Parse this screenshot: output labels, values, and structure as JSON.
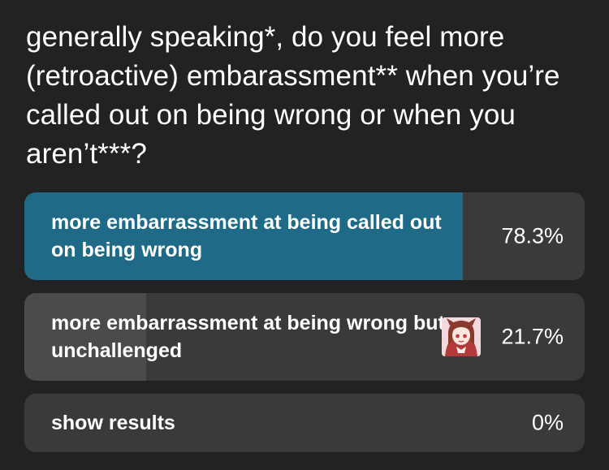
{
  "poll": {
    "question": "generally speaking*, do you feel more (retroactive) embarassment** when you’re called out on being wrong or when you aren’t***?",
    "colors": {
      "background": "#222222",
      "option_bg": "#3a3a3a",
      "selected_fill": "#1f6a86",
      "unselected_fill": "#4b4b4b",
      "text": "#ffffff"
    },
    "options": [
      {
        "label": "more embarrassment at being called out on being wrong",
        "percent": "78.3%",
        "fraction": 0.783,
        "selected": true
      },
      {
        "label": "more embarrassment at being wrong but unchallenged",
        "percent": "21.7%",
        "fraction": 0.217,
        "selected": false,
        "avatar_icon": "user-avatar-icon"
      }
    ],
    "show_results": {
      "label": "show results",
      "percent": "0%"
    }
  }
}
